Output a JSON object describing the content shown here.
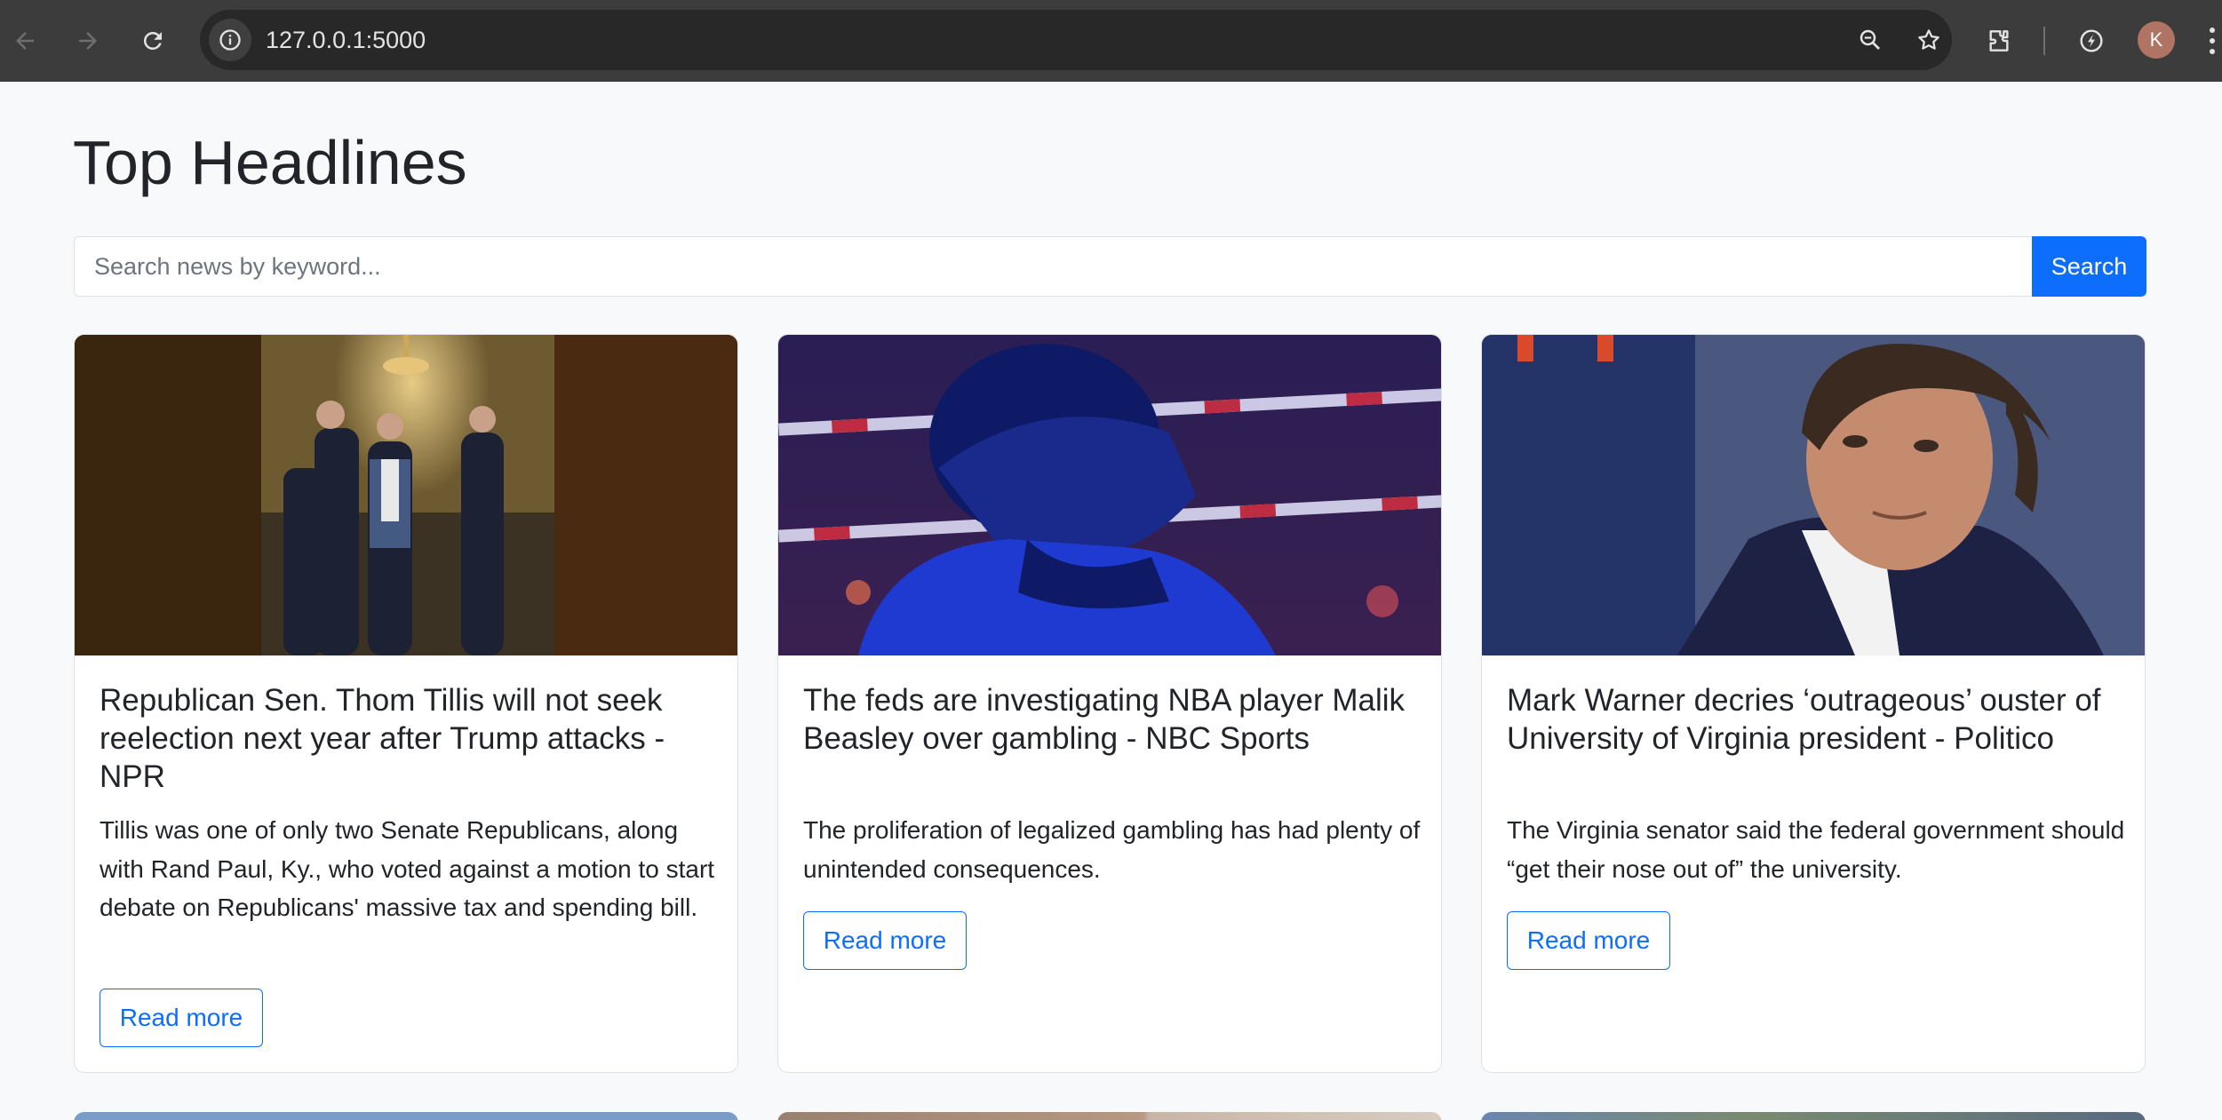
{
  "browser": {
    "url": "127.0.0.1:5000",
    "profile_initial": "K",
    "icons": [
      "back-arrow-icon",
      "forward-arrow-icon",
      "reload-icon",
      "site-info-icon",
      "zoom-icon",
      "star-icon",
      "extensions-icon",
      "performance-icon",
      "more-icon"
    ]
  },
  "page": {
    "title": "Top Headlines"
  },
  "search": {
    "placeholder": "Search news by keyword...",
    "button_label": "Search"
  },
  "colors": {
    "primary": "#0d6efd",
    "page_bg": "#f8f9fa",
    "chrome_bg": "#3c3c3c"
  },
  "articles": [
    {
      "title": "Republican Sen. Thom Tillis will not seek reelection next year after Trump attacks - NPR",
      "description": "Tillis was one of only two Senate Republicans, along with Rand Paul, Ky., who voted against a motion to start debate on Republicans' massive tax and spending bill.",
      "button_label": "Read more"
    },
    {
      "title": "The feds are investigating NBA player Malik Beasley over gambling - NBC Sports",
      "description": "The proliferation of legalized gambling has had plenty of unintended consequences.",
      "button_label": "Read more"
    },
    {
      "title": "Mark Warner decries ‘outrageous’ ouster of University of Virginia president - Politico",
      "description": "The Virginia senator said the federal government should “get their nose out of” the university.",
      "button_label": "Read more"
    }
  ]
}
